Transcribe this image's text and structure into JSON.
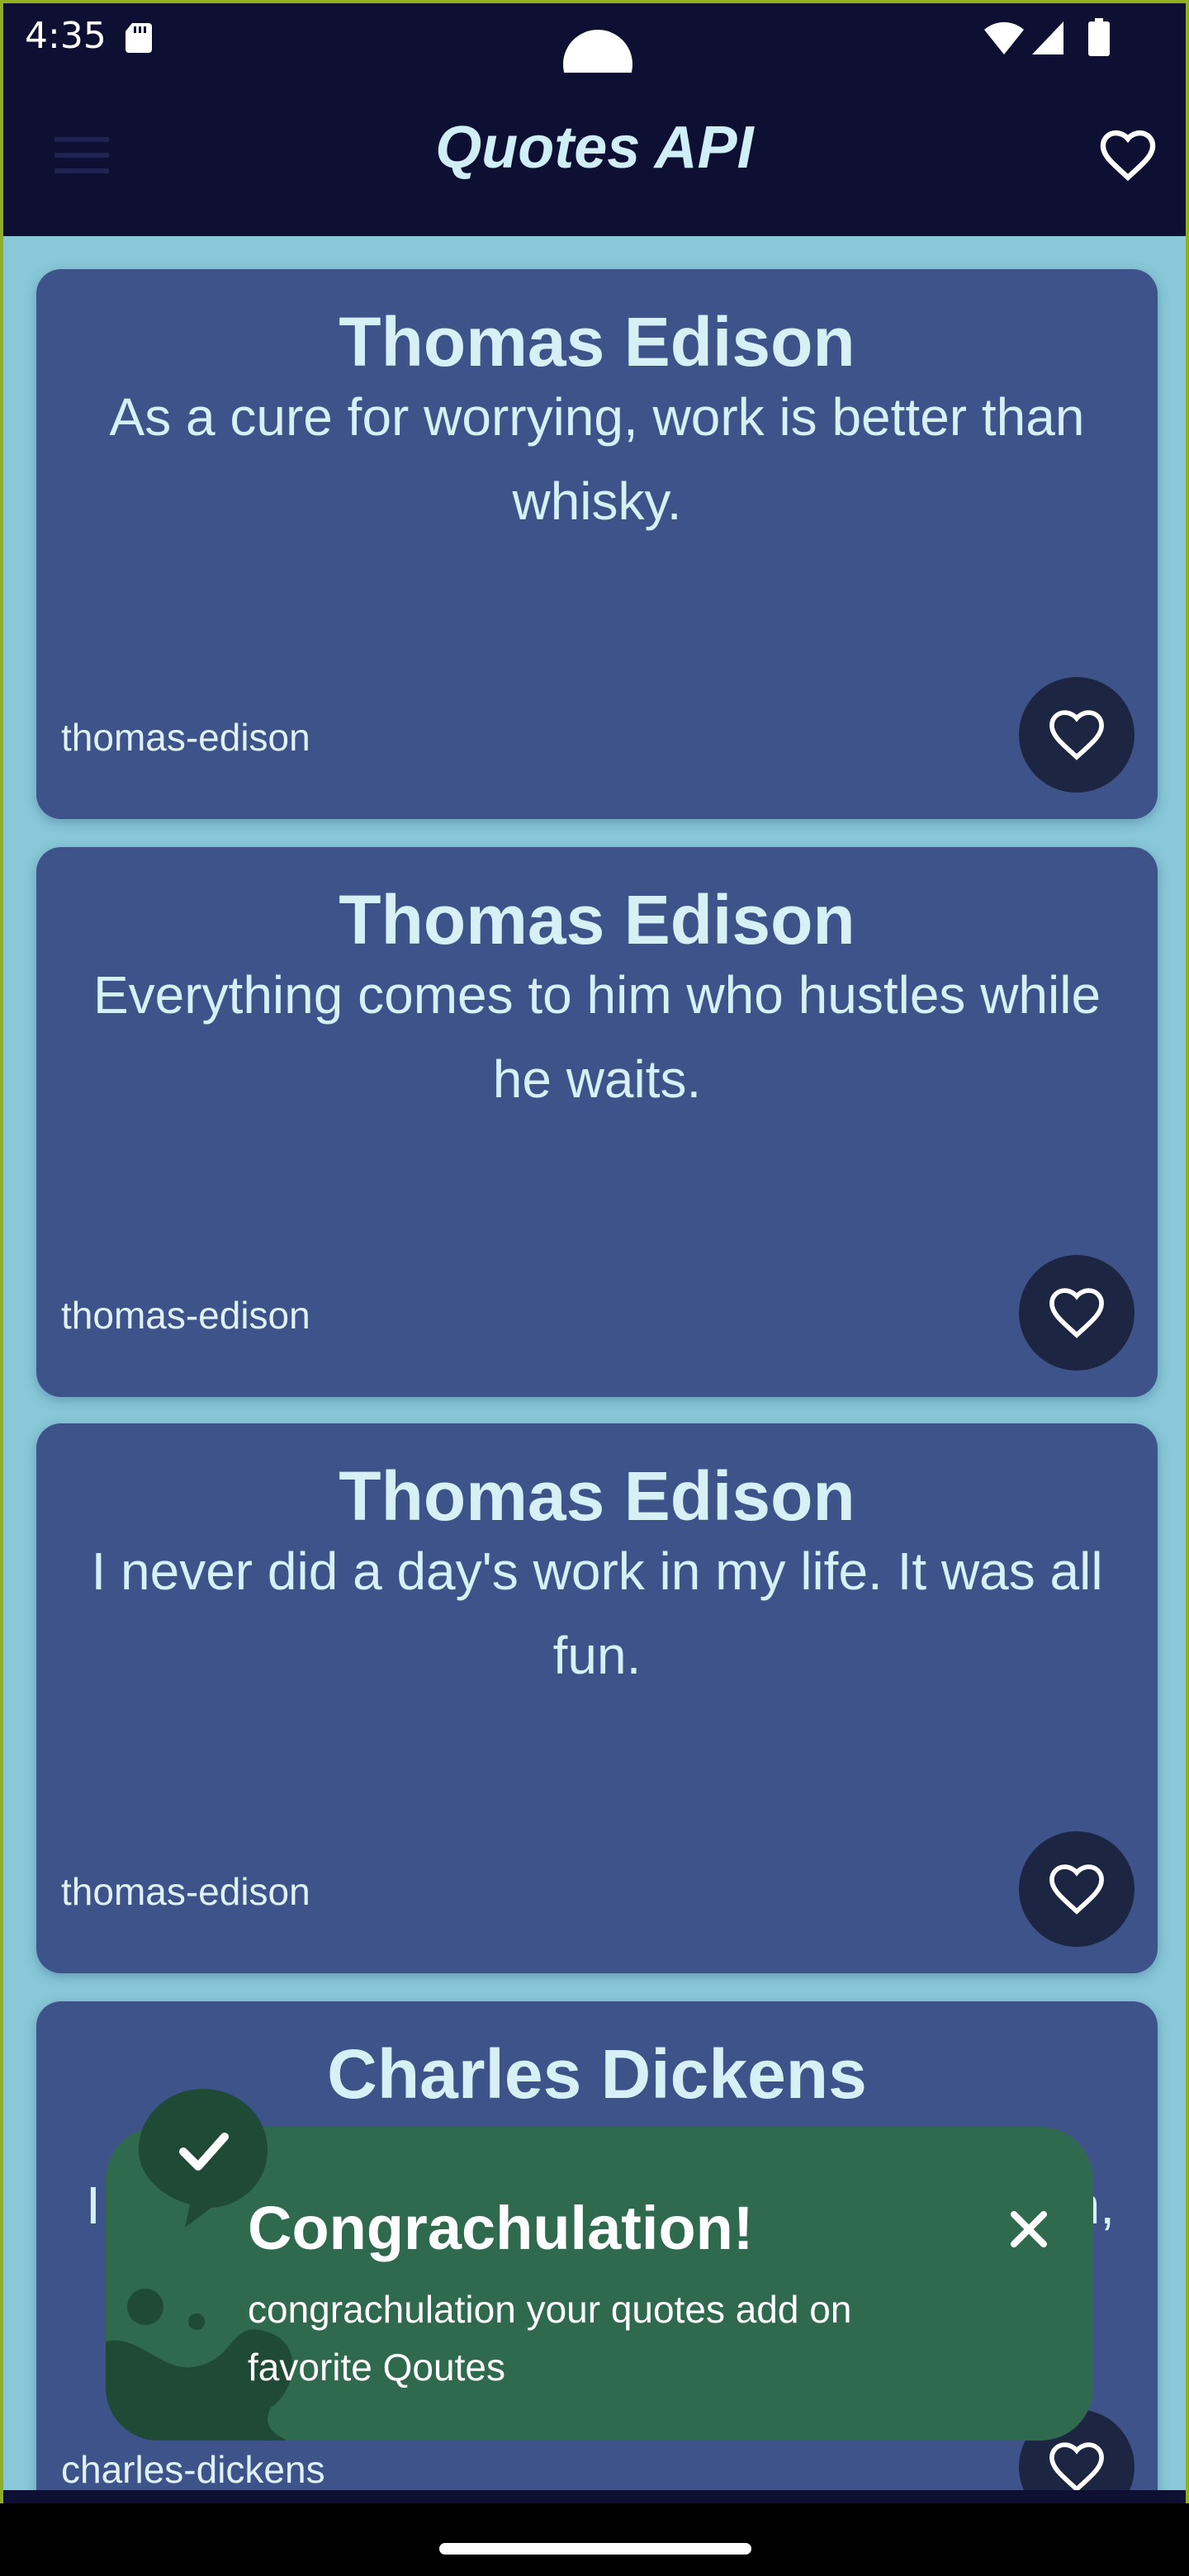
{
  "status_bar": {
    "time": "4:35",
    "icons": [
      "sd-card-icon",
      "wifi-icon",
      "signal-icon",
      "battery-icon"
    ]
  },
  "app_bar": {
    "title": "Quotes API",
    "menu_icon": "hamburger-menu-icon",
    "favorite_icon": "heart-outline-icon"
  },
  "quotes": [
    {
      "author": "Thomas Edison",
      "quote": "As a cure for worrying, work is better than whisky.",
      "slug": "thomas-edison"
    },
    {
      "author": "Thomas Edison",
      "quote": "Everything comes to him who hustles while he waits.",
      "slug": "thomas-edison"
    },
    {
      "author": "Thomas Edison",
      "quote": "I never did a day's work in my life.  It was all fun.",
      "slug": "thomas-edison"
    },
    {
      "author": "Charles Dickens",
      "quote": "I",
      "quote_tail": "n,",
      "slug": "charles-dickens"
    }
  ],
  "toast": {
    "title": "Congrachulation!",
    "message": "congrachulation your quotes add on favorite Qoutes",
    "icon": "check-icon",
    "close_icon": "close-icon"
  },
  "colors": {
    "app_bar": "#0d0f33",
    "background": "#88c8d8",
    "card": "#3d538a",
    "fav_button": "#1c2541",
    "toast": "#2f6a4f",
    "text_light": "#d6f0f6"
  }
}
